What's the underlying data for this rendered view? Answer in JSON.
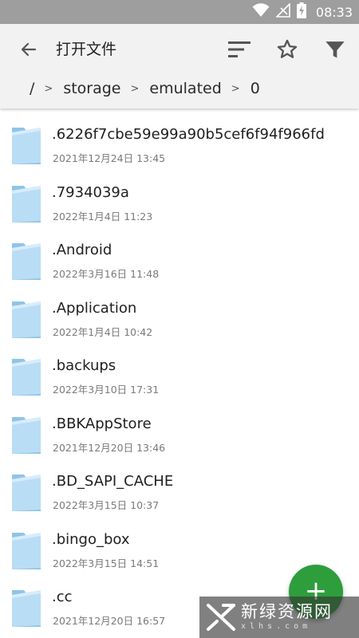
{
  "status_bar": {
    "time": "08:33",
    "icons": [
      "wifi-icon",
      "no-signal-icon",
      "battery-charging-icon"
    ]
  },
  "app_bar": {
    "title": "打开文件",
    "actions": [
      "sort-icon",
      "star-icon",
      "filter-icon"
    ]
  },
  "breadcrumb": {
    "items": [
      "/",
      "storage",
      "emulated",
      "0"
    ],
    "separator": ">"
  },
  "files": [
    {
      "name": ".6226f7cbe59e99a90b5cef6f94f966fd",
      "date": "2021年12月24日 13:45"
    },
    {
      "name": ".7934039a",
      "date": "2022年1月4日 11:23"
    },
    {
      "name": ".Android",
      "date": "2022年3月16日 11:48"
    },
    {
      "name": ".Application",
      "date": "2022年1月4日 10:42"
    },
    {
      "name": ".backups",
      "date": "2022年3月10日 17:31"
    },
    {
      "name": ".BBKAppStore",
      "date": "2021年12月20日 13:46"
    },
    {
      "name": ".BD_SAPI_CACHE",
      "date": "2022年3月15日 10:37"
    },
    {
      "name": ".bingo_box",
      "date": "2022年3月15日 14:51"
    },
    {
      "name": ".cc",
      "date": "2021年12月20日 16:57"
    }
  ],
  "fab": {
    "label": "+"
  },
  "watermark": {
    "text_cn": "新绿资源网",
    "text_en": "xlhs.com"
  },
  "colors": {
    "status_bar": "#9e9e9e",
    "app_bar": "#f2f2f2",
    "fab": "#2e9d3c",
    "folder": "#a9d5f2"
  }
}
